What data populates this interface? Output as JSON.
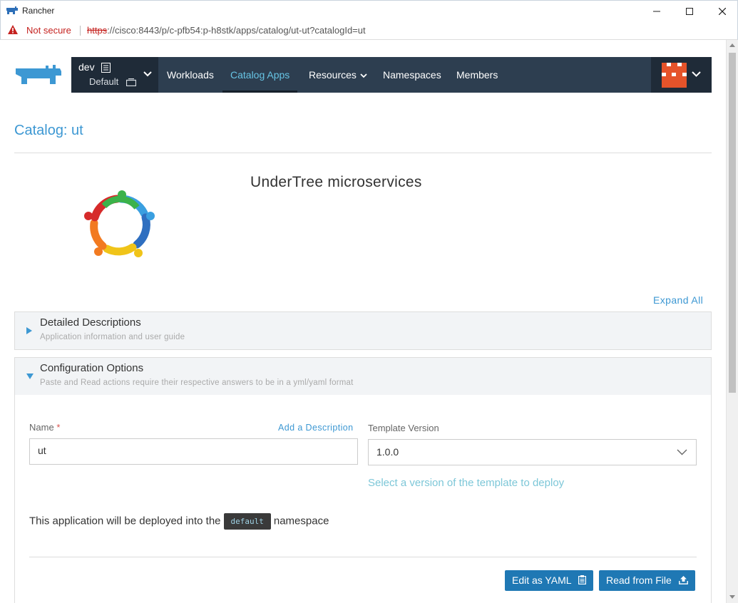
{
  "window": {
    "title": "Rancher",
    "controls": [
      "minimize-icon",
      "maximize-icon",
      "close-icon"
    ]
  },
  "address_bar": {
    "security_label": "Not secure",
    "url_scheme": "https",
    "url_rest": "://cisco:8443/p/c-pfb54:p-h8stk/apps/catalog/ut-ut?catalogId=ut"
  },
  "header": {
    "cluster_name": "dev",
    "project_name": "Default",
    "nav": [
      {
        "label": "Workloads",
        "active": false
      },
      {
        "label": "Catalog Apps",
        "active": true
      },
      {
        "label": "Resources",
        "active": false,
        "dropdown": true
      },
      {
        "label": "Namespaces",
        "active": false
      },
      {
        "label": "Members",
        "active": false
      }
    ]
  },
  "page": {
    "title": "Catalog: ut",
    "app_name": "UnderTree microservices",
    "expand_all": "Expand All"
  },
  "panels": {
    "details": {
      "title": "Detailed Descriptions",
      "subtitle": "Application information and user guide",
      "expanded": false
    },
    "config": {
      "title": "Configuration Options",
      "subtitle": "Paste and Read actions require their respective answers to be in a yml/yaml format",
      "expanded": true
    }
  },
  "form": {
    "name_label": "Name",
    "required_mark": "*",
    "add_description": "Add a Description",
    "name_value": "ut",
    "template_version_label": "Template Version",
    "template_version_value": "1.0.0",
    "template_version_help": "Select a version of the template to deploy",
    "deploy_prefix": "This application will be deployed into the",
    "namespace": "default",
    "deploy_suffix": "namespace"
  },
  "actions": {
    "edit_yaml": "Edit as YAML",
    "read_file": "Read from File"
  },
  "colors": {
    "accent": "#3d98d3",
    "navbar": "#2d3e50",
    "button": "#1f78b4",
    "avatar": "#e5532a"
  }
}
